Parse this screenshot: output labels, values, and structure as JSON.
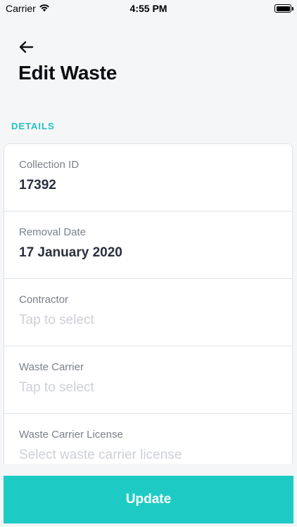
{
  "status_bar": {
    "carrier": "Carrier",
    "time": "4:55 PM",
    "battery_level": 1.0
  },
  "header": {
    "back_icon": "arrow-left-icon",
    "title": "Edit Waste"
  },
  "section": {
    "label": "DETAILS"
  },
  "fields": [
    {
      "label": "Collection ID",
      "value": "17392"
    },
    {
      "label": "Removal Date",
      "value": "17 January 2020"
    },
    {
      "label": "Contractor",
      "placeholder": "Tap to select"
    },
    {
      "label": "Waste Carrier",
      "placeholder": "Tap to select"
    },
    {
      "label": "Waste Carrier License",
      "placeholder": "Select waste carrier license"
    }
  ],
  "footer": {
    "update_label": "Update"
  },
  "colors": {
    "accent": "#1ecbc4",
    "section_label": "#22c1c3",
    "background": "#f5f6f7"
  }
}
